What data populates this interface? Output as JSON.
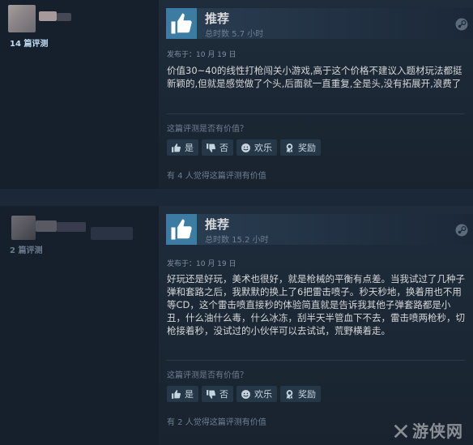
{
  "reviews": [
    {
      "reviewer_count": "14 篇评测",
      "verdict": "推荐",
      "hours": "总时数 5.7 小时",
      "posted": "发布于：10 月 19 日",
      "body": "价值30~40的线性打枪闯关小游戏,高于这个价格不建议入题材玩法都挺新颖的,但就是感觉做了个头,后面就一直重复,全是头,没有拓展开,浪费了",
      "helpful_question": "这篇评测是否有价值？",
      "vote_yes": "是",
      "vote_no": "否",
      "vote_funny": "欢乐",
      "vote_award": "奖励",
      "found_helpful": "有 4 人觉得这篇评测有价值"
    },
    {
      "reviewer_count": "2 篇评测",
      "verdict": "推荐",
      "hours": "总时数 15.2 小时",
      "posted": "发布于：10 月 19 日",
      "body": "好玩还是好玩，美术也很好，就是枪械的平衡有点差。当我试过了几种子弹和套路之后，我默默的换上了6把雷击喷子。秒天秒地，换着用也不用等CD，这个雷击喷直接秒的体验简直就是告诉我其他子弹套路都是小丑，什么油什么毒，什么冰冻，刮半天半管血下不去，雷击喷两枪秒，切枪接着秒，没试过的小伙伴可以去试试，荒野横着走。",
      "helpful_question": "这篇评测是否有价值？",
      "vote_yes": "是",
      "vote_no": "否",
      "vote_funny": "欢乐",
      "vote_award": "奖励",
      "found_helpful": "有 2 人觉得这篇评测有价值"
    }
  ],
  "watermark": "游侠网",
  "colors": {
    "background": "#1b2838",
    "thumb_bg": "#3c7ca2",
    "text": "#d6d7d8",
    "muted": "#6e7f91"
  },
  "icons": [
    "thumbs-up-icon",
    "thumbs-down-icon",
    "smiley-icon",
    "award-icon",
    "steam-icon"
  ]
}
